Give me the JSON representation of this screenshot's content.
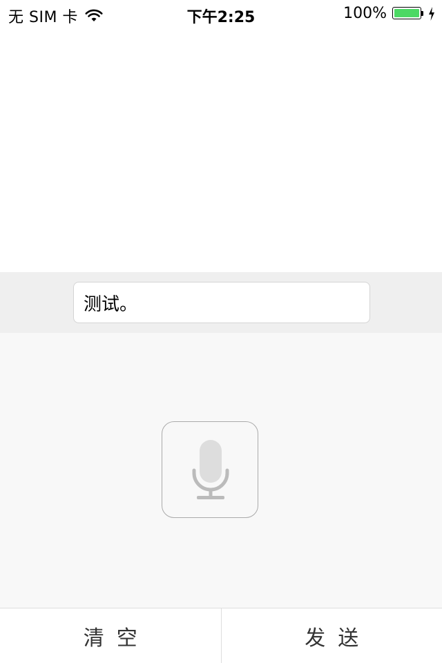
{
  "status_bar": {
    "carrier": "无 SIM 卡",
    "time": "下午2:25",
    "battery_percent": "100%",
    "battery_level": 1.0,
    "battery_color": "#4cd964"
  },
  "input": {
    "value": "测试。"
  },
  "voice": {
    "icon": "microphone-icon"
  },
  "toolbar": {
    "clear_label": "清空",
    "send_label": "发送"
  }
}
